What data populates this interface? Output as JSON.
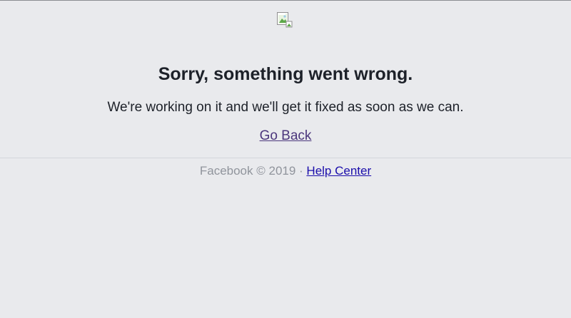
{
  "logo": {
    "icon": "broken-image-icon"
  },
  "error": {
    "headline": "Sorry, something went wrong.",
    "message": "We're working on it and we'll get it fixed as soon as we can.",
    "go_back_label": "Go Back"
  },
  "footer": {
    "copyright": "Facebook © 2019 · ",
    "help_center_label": "Help Center"
  },
  "colors": {
    "background": "#e9eaed",
    "text": "#1d2129",
    "visited_link": "#4b367c",
    "link": "#1a0dab",
    "footer_text": "#90949c"
  }
}
